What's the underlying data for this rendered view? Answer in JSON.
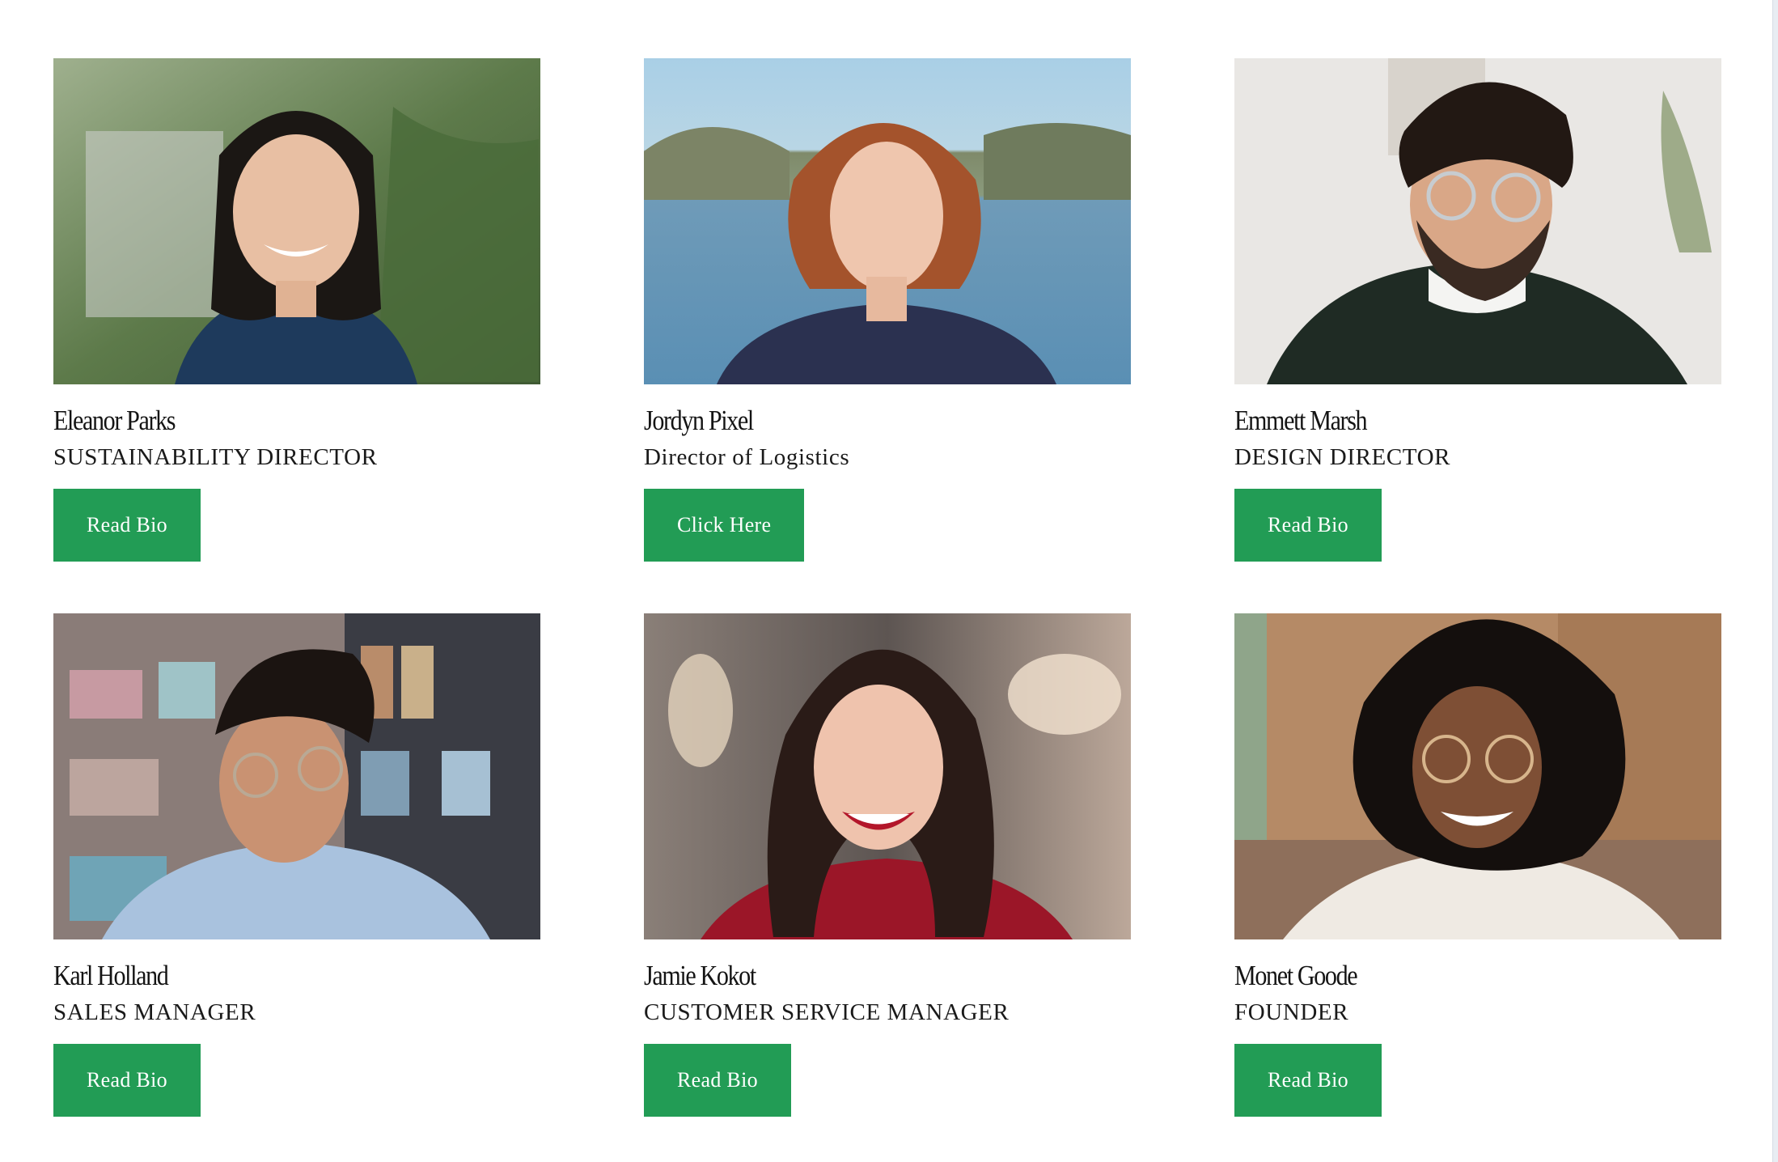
{
  "team": [
    {
      "name": "Eleanor Parks",
      "role": "SUSTAINABILITY DIRECTOR",
      "button": "Read Bio",
      "photo": "portrait-smiling-woman-ferns"
    },
    {
      "name": "Jordyn Pixel",
      "role": "Director of Logistics",
      "button": "Click Here",
      "photo": "portrait-redhead-woman-lake"
    },
    {
      "name": "Emmett Marsh",
      "role": "DESIGN DIRECTOR",
      "button": "Read Bio",
      "photo": "portrait-bearded-man-glasses"
    },
    {
      "name": "Karl Holland",
      "role": "SALES MANAGER",
      "button": "Read Bio",
      "photo": "portrait-man-glasses-shelves"
    },
    {
      "name": "Jamie Kokot",
      "role": "CUSTOMER SERVICE MANAGER",
      "button": "Read Bio",
      "photo": "portrait-laughing-woman-red"
    },
    {
      "name": "Monet Goode",
      "role": "FOUNDER",
      "button": "Read Bio",
      "photo": "portrait-smiling-woman-glasses"
    }
  ],
  "colors": {
    "button_bg": "#229c55",
    "button_text": "#ffffff",
    "text": "#1a1a1a",
    "background": "#ffffff"
  }
}
